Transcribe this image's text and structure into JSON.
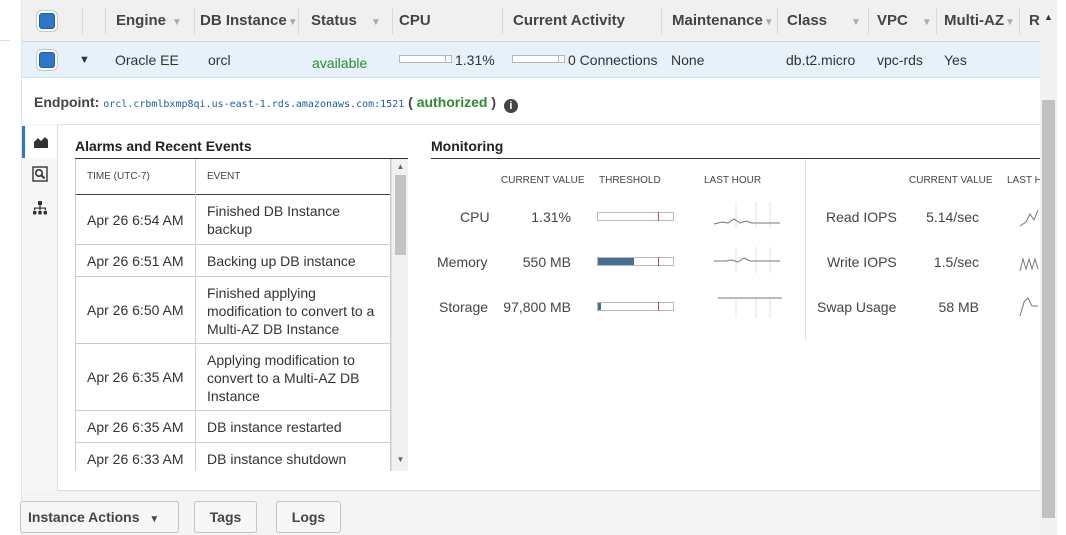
{
  "header": {
    "columns": [
      "Engine",
      "DB Instance",
      "Status",
      "CPU",
      "Current Activity",
      "Maintenance",
      "Class",
      "VPC",
      "Multi-AZ",
      "R"
    ]
  },
  "instance": {
    "engine": "Oracle EE",
    "db_instance": "orcl",
    "status": "available",
    "cpu": "1.31%",
    "activity": "0 Connections",
    "maintenance": "None",
    "class": "db.t2.micro",
    "vpc": "vpc-rds",
    "multi_az": "Yes"
  },
  "endpoint": {
    "label": "Endpoint:",
    "value": "orcl.crbmlbxmp8qi.us-east-1.rds.amazonaws.com:1521",
    "open_paren": "(",
    "status": "authorized",
    "close_paren": ")"
  },
  "alarms": {
    "title": "Alarms and Recent Events",
    "col_time": "TIME (UTC-7)",
    "col_event": "EVENT",
    "events": [
      {
        "time": "Apr 26 6:54 AM",
        "event": "Finished DB Instance backup"
      },
      {
        "time": "Apr 26 6:51 AM",
        "event": "Backing up DB instance"
      },
      {
        "time": "Apr 26 6:50 AM",
        "event": "Finished applying modification to convert to a Multi-AZ DB Instance"
      },
      {
        "time": "Apr 26 6:35 AM",
        "event": "Applying modification to convert to a Multi-AZ DB Instance"
      },
      {
        "time": "Apr 26 6:35 AM",
        "event": "DB instance restarted"
      },
      {
        "time": "Apr 26 6:33 AM",
        "event": "DB instance shutdown"
      }
    ]
  },
  "monitoring": {
    "title": "Monitoring",
    "col_current": "CURRENT VALUE",
    "col_threshold": "THRESHOLD",
    "col_last_hour": "LAST HOUR",
    "col_last_hour_right": "LAST H",
    "left": [
      {
        "label": "CPU",
        "value": "1.31%",
        "fill": 0.0
      },
      {
        "label": "Memory",
        "value": "550 MB",
        "fill": 0.48
      },
      {
        "label": "Storage",
        "value": "97,800 MB",
        "fill": 0.03
      }
    ],
    "right": [
      {
        "label": "Read IOPS",
        "value": "5.14/sec"
      },
      {
        "label": "Write IOPS",
        "value": "1.5/sec"
      },
      {
        "label": "Swap Usage",
        "value": "58 MB"
      }
    ]
  },
  "actions": {
    "instance_actions": "Instance Actions",
    "tags": "Tags",
    "logs": "Logs"
  },
  "colors": {
    "accent": "#2d77c8",
    "status_green": "#2f8a2f",
    "row_selected": "#e7f1fa"
  }
}
